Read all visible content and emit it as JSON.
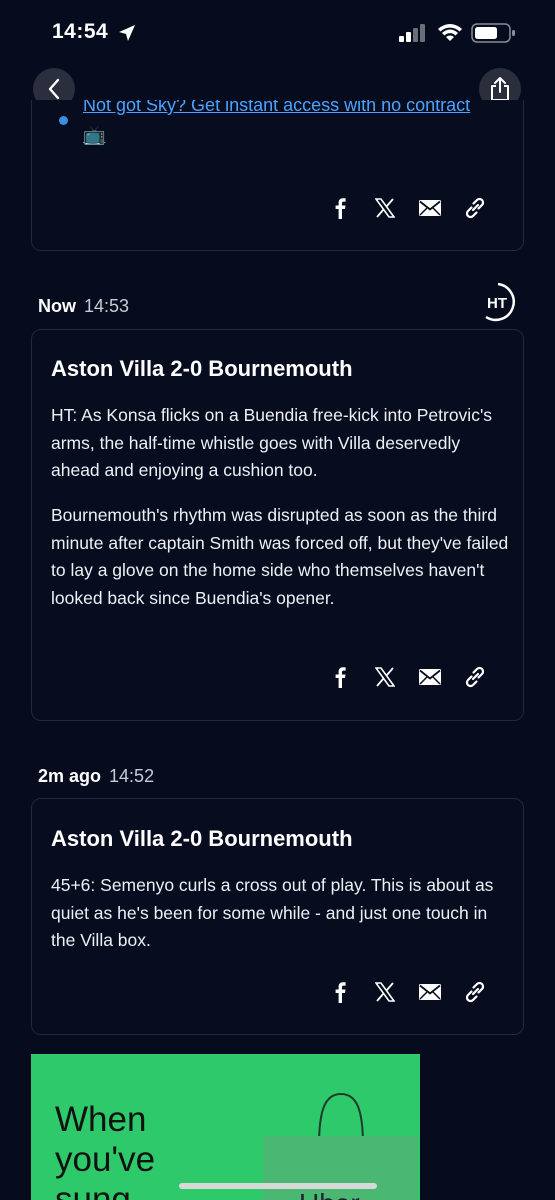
{
  "status_bar": {
    "time": "14:54"
  },
  "top_card": {
    "bullet_text": "Not got Sky? Get instant access with no contract📺"
  },
  "entries": [
    {
      "ago": "Now",
      "time": "14:53",
      "badge": "HT",
      "title": "Aston Villa 2-0 Bournemouth",
      "paragraphs": [
        "HT: As Konsa flicks on a Buendia free-kick into Petrovic's arms, the half-time whistle goes with Villa deservedly ahead and enjoying a cushion too.",
        "Bournemouth's rhythm was disrupted as soon as the third minute after captain Smith was forced off, but they've failed to lay a glove on the home side who themselves haven't looked back since Buendia's opener."
      ]
    },
    {
      "ago": "2m ago",
      "time": "14:52",
      "title": "Aston Villa 2-0 Bournemouth",
      "paragraphs": [
        "45+6: Semenyo curls a cross out of play. This is about as quiet as he's been for some while - and just one touch in the Villa box."
      ]
    }
  ],
  "ad": {
    "headline": "When\nyou've\nsung",
    "bag_label": "Uber"
  },
  "icons": {
    "back": "chevron-left-icon",
    "share": "share-icon",
    "facebook": "facebook-icon",
    "x": "x-icon",
    "email": "email-icon",
    "link": "link-icon"
  },
  "colors": {
    "background": "#060b1e",
    "link": "#4aa3ff",
    "ad_green": "#2ec96b"
  }
}
